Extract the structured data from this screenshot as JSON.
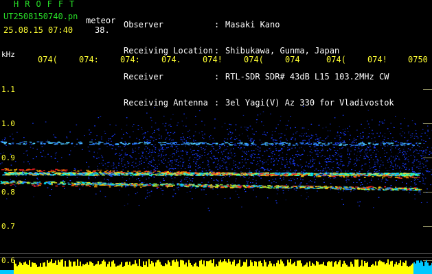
{
  "header": {
    "brand": "HROFFT",
    "filename": "UT2508150740.pn",
    "event_type": "meteor",
    "datetime": "25.08.15 07:40",
    "count": "38.",
    "meta": [
      {
        "label": "Observer",
        "value": "Masaki Kano"
      },
      {
        "label": "Receiving Location",
        "value": "Shibukawa, Gunma, Japan"
      },
      {
        "label": "Receiver",
        "value": "RTL-SDR SDR# 43dB L15 103.2MHz CW"
      },
      {
        "label": "Receiving Antenna",
        "value": "3el Yagi(V) Az 330 for Vladivostok"
      }
    ]
  },
  "axis": {
    "unit": "kHz",
    "time_ticks": [
      "074(",
      "074:",
      "074:",
      "074.",
      "074!",
      "074(",
      "074",
      "074(",
      "074!",
      "0750"
    ],
    "freq_ticks": [
      "1.1",
      "1.0",
      "0.9",
      "0.8",
      "0.7",
      "0.6"
    ]
  },
  "colors": {
    "label_green": "#28e028",
    "label_white": "#ffffff",
    "tick_yellow": "#ffff33",
    "noise_blue": "#1a3cff",
    "signal_red": "#ff2020",
    "amplitude_yellow": "#ffff00",
    "amplitude_cyan": "#00c8ff"
  }
}
